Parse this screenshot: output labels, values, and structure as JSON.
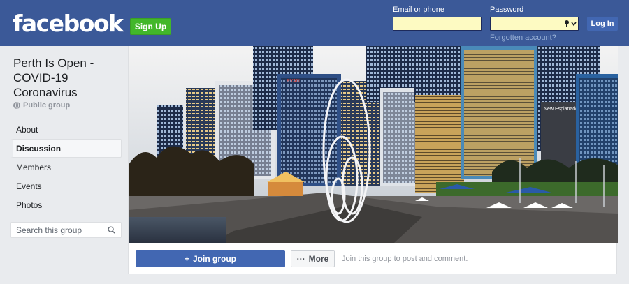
{
  "header": {
    "logo": "facebook",
    "signup_label": "Sign Up",
    "email_label": "Email or phone",
    "password_label": "Password",
    "forgot_label": "Forgotten account?",
    "login_label": "Log In",
    "brand_color": "#3b5998"
  },
  "group": {
    "name": "Perth Is Open - COVID-19 Coronavirus",
    "privacy": "Public group"
  },
  "sidebar": {
    "items": [
      {
        "label": "About"
      },
      {
        "label": "Discussion"
      },
      {
        "label": "Members"
      },
      {
        "label": "Events"
      },
      {
        "label": "Photos"
      }
    ],
    "active_index": 1,
    "search_placeholder": "Search this group"
  },
  "cover": {
    "neon_signs": [
      "RYAN",
      "New Esplanade Hotel"
    ]
  },
  "actions": {
    "join_label": "Join group",
    "more_label": "More",
    "hint": "Join this group to post and comment."
  }
}
